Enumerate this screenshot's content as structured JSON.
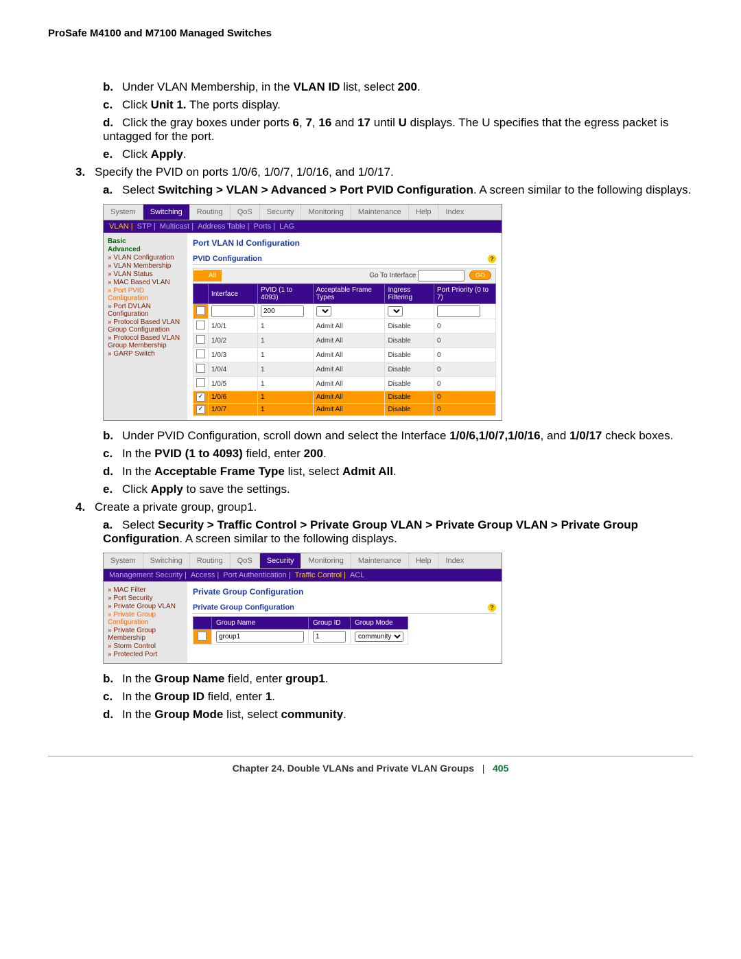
{
  "running_head": "ProSafe M4100 and M7100 Managed Switches",
  "steps": {
    "b": "Under VLAN Membership, in the ",
    "b_bold1": "VLAN ID",
    "b_tail": " list, select ",
    "b_bold2": "200",
    "b_period": ".",
    "c": "Click ",
    "c_bold": "Unit 1.",
    "c_tail": " The ports display.",
    "d": "Click the gray boxes under ports ",
    "d_b1": "6",
    "d_c1": ", ",
    "d_b2": "7",
    "d_c2": ", ",
    "d_b3": "16",
    "d_c3": " and ",
    "d_b4": "17",
    "d_tail": " until ",
    "d_b5": "U",
    "d_tail2": " displays. The U specifies that the egress packet is untagged for the port.",
    "e": "Click ",
    "e_bold": "Apply",
    "e_period": ".",
    "s3": "Specify the PVID on ports 1/0/6, 1/0/7, 1/0/16, and 1/0/17.",
    "s3a": "Select ",
    "s3a_bold": "Switching > VLAN > Advanced > Port PVID Configuration",
    "s3a_tail": ". A screen similar to the following displays.",
    "s3b": "Under PVID Configuration, scroll down and select the Interface ",
    "s3b_b": "1/0/6,1/0/7,1/0/16",
    "s3b_mid": ", and ",
    "s3b_b2": "1/0/17",
    "s3b_tail": " check boxes.",
    "s3c": "In the ",
    "s3c_bold": "PVID (1 to 4093)",
    "s3c_mid": " field, enter ",
    "s3c_bold2": "200",
    "s3c_period": ".",
    "s3d": "In the ",
    "s3d_bold": "Acceptable Frame Type",
    "s3d_mid": " list, select ",
    "s3d_bold2": "Admit All",
    "s3d_period": ".",
    "s3e": "Click ",
    "s3e_bold": "Apply",
    "s3e_tail": " to save the settings.",
    "s4": "Create a private group, group1.",
    "s4a": "Select ",
    "s4a_bold": "Security > Traffic Control > Private Group VLAN > Private Group VLAN > Private Group Configuration",
    "s4a_tail": ". A screen similar to the following displays.",
    "s4b": "In the ",
    "s4b_bold": "Group Name",
    "s4b_mid": " field, enter ",
    "s4b_bold2": "group1",
    "s4b_period": ".",
    "s4c": "In the ",
    "s4c_bold": "Group ID",
    "s4c_mid": " field, enter ",
    "s4c_bold2": "1",
    "s4c_period": ".",
    "s4d": "In the ",
    "s4d_bold": "Group Mode",
    "s4d_mid": " list, select ",
    "s4d_bold2": "community",
    "s4d_period": "."
  },
  "ui1": {
    "tabs": [
      "System",
      "Switching",
      "Routing",
      "QoS",
      "Security",
      "Monitoring",
      "Maintenance",
      "Help",
      "Index"
    ],
    "active_tab": "Switching",
    "subnav": [
      "VLAN",
      "STP",
      "Multicast",
      "Address Table",
      "Ports",
      "LAG"
    ],
    "subnav_sel": "VLAN",
    "side": {
      "basic": "Basic",
      "advanced": "Advanced",
      "items": [
        "VLAN Configuration",
        "VLAN Membership",
        "VLAN Status",
        "MAC Based VLAN",
        "Port PVID Configuration",
        "Port DVLAN Configuration",
        "Protocol Based VLAN Group Configuration",
        "Protocol Based VLAN Group Membership",
        "GARP Switch"
      ],
      "selected": "Port PVID Configuration"
    },
    "title": "Port VLAN Id Configuration",
    "boxtitle": "PVID Configuration",
    "toolbar_all": "All",
    "toolbar_goto": "Go To Interface",
    "toolbar_go": "GO",
    "headers": [
      "",
      "Interface",
      "PVID (1 to 4093)",
      "Acceptable Frame Types",
      "Ingress Filtering",
      "Port Priority (0 to 7)"
    ],
    "filter_pvid": "200",
    "rows": [
      {
        "chk": false,
        "if": "1/0/1",
        "pvid": "1",
        "aft": "Admit All",
        "ing": "Disable",
        "prio": "0",
        "sel": false,
        "alt": false
      },
      {
        "chk": false,
        "if": "1/0/2",
        "pvid": "1",
        "aft": "Admit All",
        "ing": "Disable",
        "prio": "0",
        "sel": false,
        "alt": true
      },
      {
        "chk": false,
        "if": "1/0/3",
        "pvid": "1",
        "aft": "Admit All",
        "ing": "Disable",
        "prio": "0",
        "sel": false,
        "alt": false
      },
      {
        "chk": false,
        "if": "1/0/4",
        "pvid": "1",
        "aft": "Admit All",
        "ing": "Disable",
        "prio": "0",
        "sel": false,
        "alt": true
      },
      {
        "chk": false,
        "if": "1/0/5",
        "pvid": "1",
        "aft": "Admit All",
        "ing": "Disable",
        "prio": "0",
        "sel": false,
        "alt": false
      },
      {
        "chk": true,
        "if": "1/0/6",
        "pvid": "1",
        "aft": "Admit All",
        "ing": "Disable",
        "prio": "0",
        "sel": true,
        "alt": false
      },
      {
        "chk": true,
        "if": "1/0/7",
        "pvid": "1",
        "aft": "Admit All",
        "ing": "Disable",
        "prio": "0",
        "sel": true,
        "alt": false
      }
    ]
  },
  "ui2": {
    "tabs": [
      "System",
      "Switching",
      "Routing",
      "QoS",
      "Security",
      "Monitoring",
      "Maintenance",
      "Help",
      "Index"
    ],
    "active_tab": "Security",
    "subnav": [
      "Management Security",
      "Access",
      "Port Authentication",
      "Traffic Control",
      "ACL"
    ],
    "subnav_sel": "Traffic Control",
    "side": {
      "items": [
        "MAC Filter",
        "Port Security",
        "Private Group VLAN",
        "Private Group Configuration",
        "Private Group Membership",
        "Storm Control",
        "Protected Port"
      ],
      "selected": "Private Group Configuration"
    },
    "title": "Private Group Configuration",
    "boxtitle": "Private Group Configuration",
    "headers": [
      "",
      "Group Name",
      "Group ID",
      "Group Mode"
    ],
    "row": {
      "name": "group1",
      "id": "1",
      "mode": "community"
    }
  },
  "footer": {
    "chapter": "Chapter 24.  Double VLANs and Private VLAN Groups",
    "sep": "|",
    "page": "405"
  }
}
